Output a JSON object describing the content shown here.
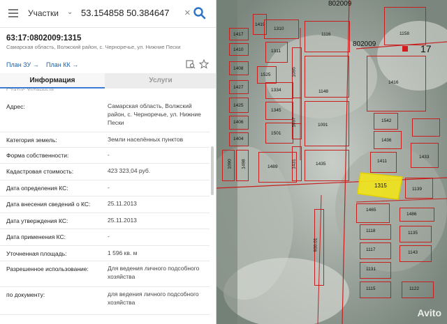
{
  "search": {
    "layer": "Участки",
    "query": "53.154858 50.384647"
  },
  "parcel": {
    "cadastral_number": "63:17:0802009:1315",
    "address_short": "Самарская область, Волжский район, с. Черноречье, ул. Нижние Пески"
  },
  "links": {
    "plan_zu": "План ЗУ",
    "plan_kk": "План КК",
    "arrow": "→"
  },
  "tabs": {
    "info": "Информация",
    "services": "Услуги"
  },
  "partial_row": "Статус                                     Учтенный",
  "attributes": [
    {
      "label": "Адрес:",
      "value": "Самарская область, Волжский район, с. Черноречье, ул. Нижние Пески"
    },
    {
      "label": "Категория земель:",
      "value": "Земли населённых пунктов"
    },
    {
      "label": "Форма собственности:",
      "value": "-"
    },
    {
      "label": "Кадастровая стоимость:",
      "value": "423 323,04 руб."
    },
    {
      "label": "Дата определения КС:",
      "value": "-"
    },
    {
      "label": "Дата внесения сведений о КС:",
      "value": "25.11.2013"
    },
    {
      "label": "Дата утверждения КС:",
      "value": "25.11.2013"
    },
    {
      "label": "Дата применения КС:",
      "value": "-"
    },
    {
      "label": "Уточненная площадь:",
      "value": "1 596 кв. м"
    },
    {
      "label": "Разрешенное использование:",
      "value": "Для ведения личного подсобного хозяйства"
    },
    {
      "label": "по документу:",
      "value": "для ведения личного подсобного хозяйства"
    }
  ],
  "map": {
    "quarter_labels": [
      "802009",
      "802009",
      "17"
    ],
    "highlighted_parcel": "1315",
    "parcel_labels": [
      "1419",
      "1417",
      "1310",
      "1116",
      "1158",
      "1416",
      "1410",
      "1311",
      "1408",
      "1525",
      "1427",
      "1334",
      "1095",
      "1148",
      "1425",
      "1345",
      "1406",
      "1404",
      "1501",
      "1542",
      "1436",
      "1097",
      "1091",
      "1489",
      "1435",
      "1411",
      "1431",
      "1090",
      "1433",
      "1498",
      "1139",
      "1465",
      "1486",
      "1122",
      "1118",
      "1135",
      "1117",
      "1143",
      "1131",
      "1115",
      "930:01"
    ],
    "watermark": "Avito"
  },
  "colors": {
    "link": "#1c5fa8",
    "tab_active_underline": "#3a7bd5",
    "parcel_border": "#c81e1e",
    "highlight_fill": "#f2e41a"
  }
}
